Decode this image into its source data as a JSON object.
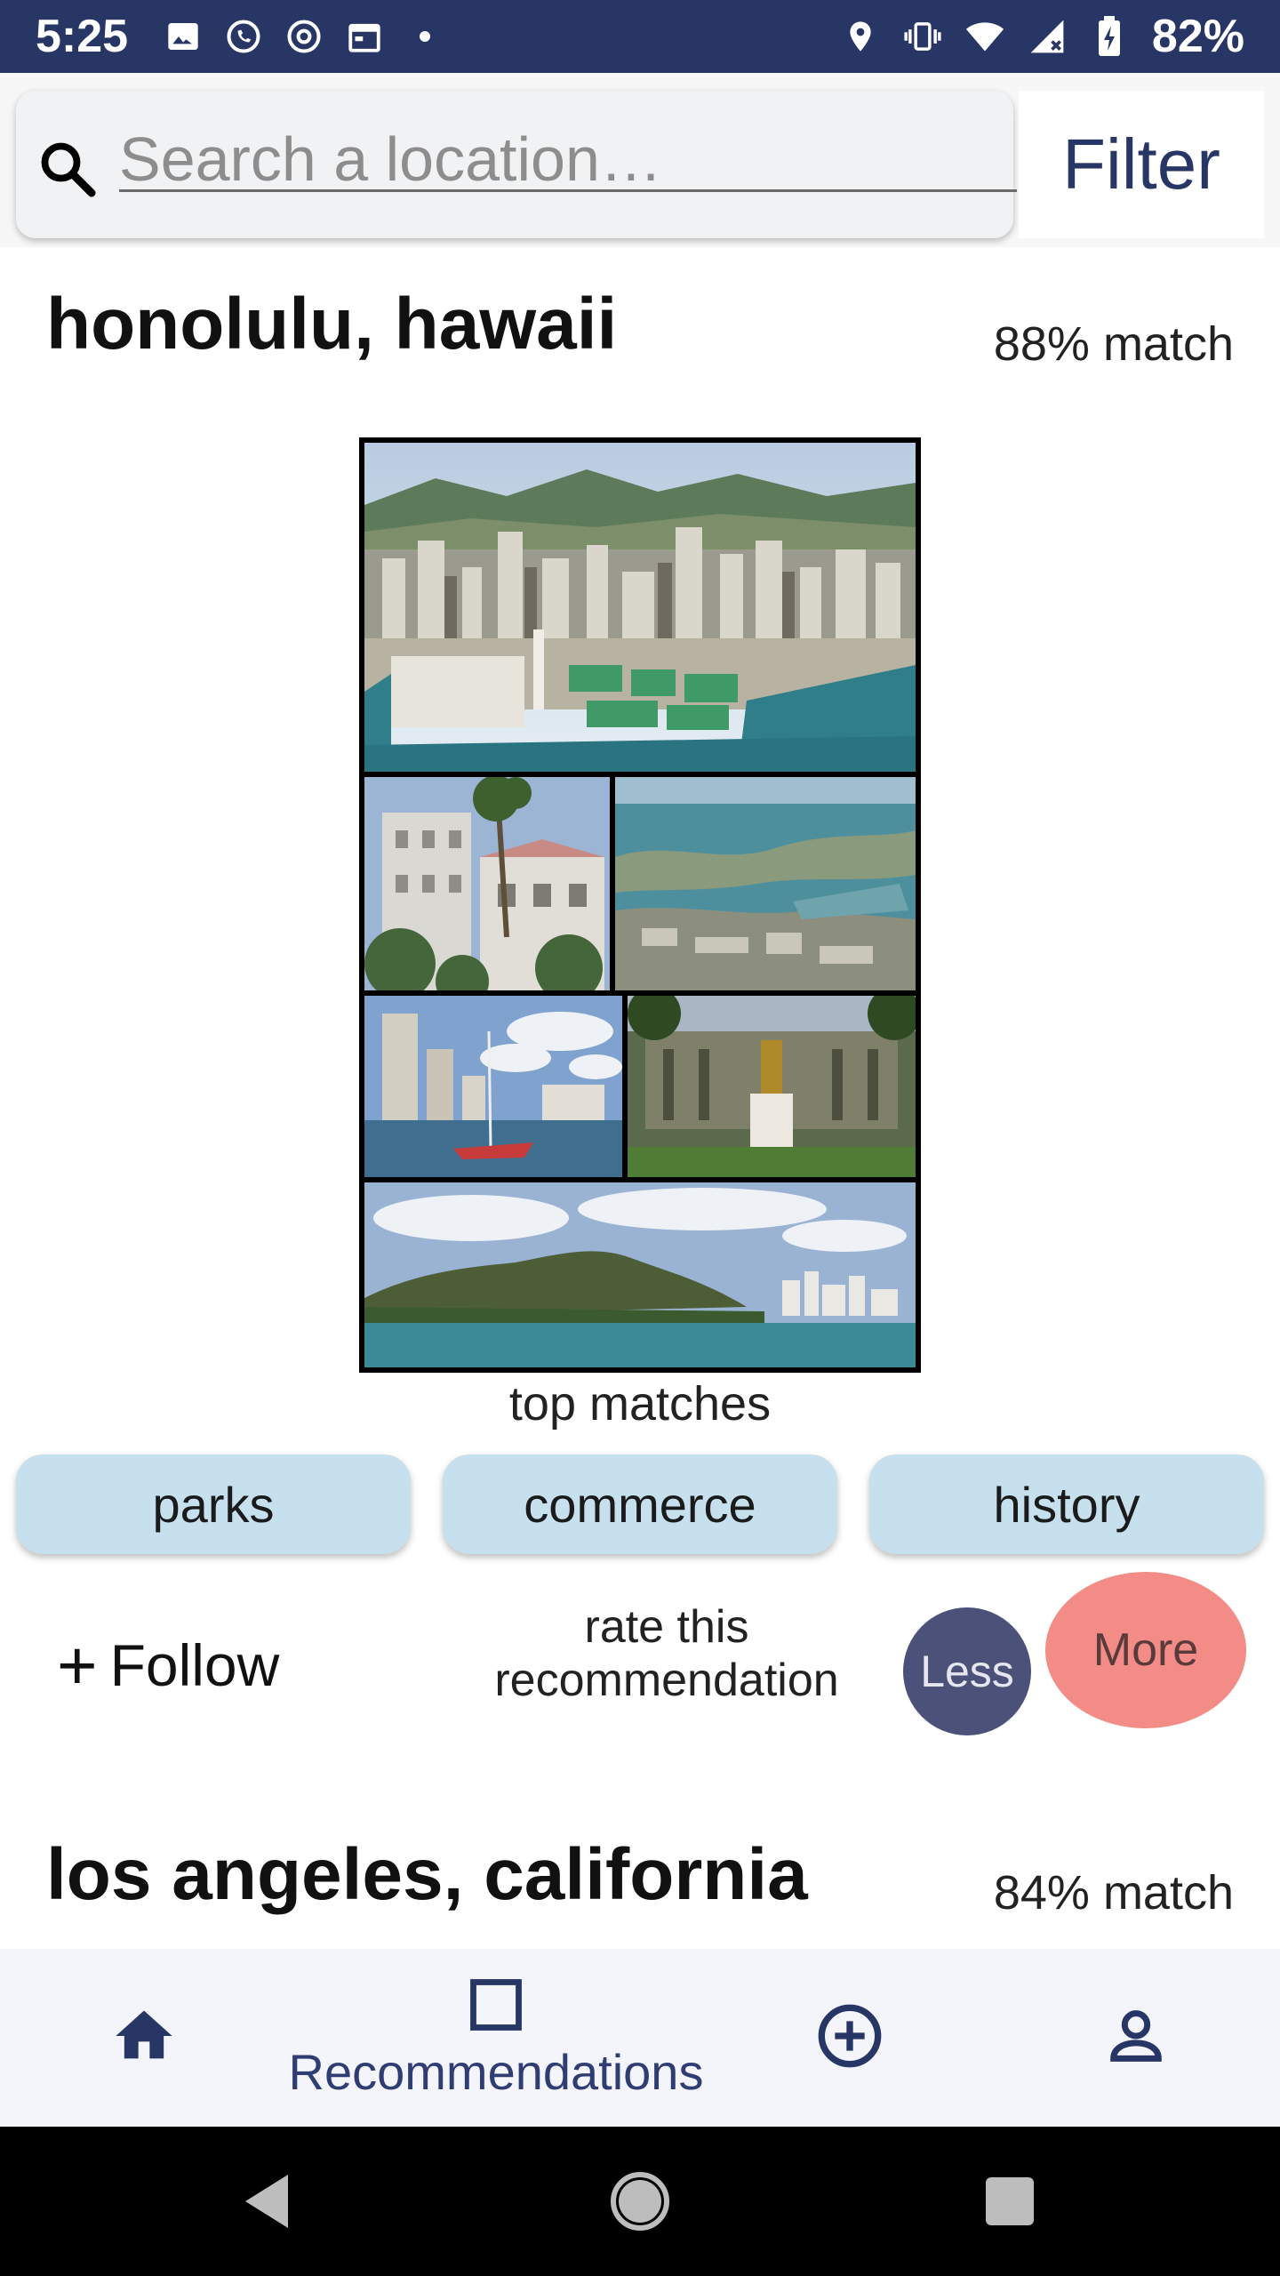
{
  "status_bar": {
    "time": "5:25",
    "battery_percent": "82%",
    "left_icons": [
      "image-icon",
      "whatsapp-icon",
      "at-sign-icon",
      "calendar-icon",
      "dot-icon"
    ],
    "right_icons": [
      "location-pin-icon",
      "vibrate-icon",
      "wifi-icon",
      "signal-icon",
      "battery-charging-icon"
    ]
  },
  "search": {
    "placeholder": "Search a location…",
    "value": "",
    "filter_label": "Filter"
  },
  "cards": [
    {
      "title": "honolulu, hawaii",
      "match": "88% match",
      "collage_caption": "top matches",
      "tags": [
        "parks",
        "commerce",
        "history"
      ],
      "follow_label": "Follow",
      "rate_label": "rate this recommendation",
      "less_label": "Less",
      "more_label": "More"
    },
    {
      "title": "los angeles, california",
      "match": "84% match"
    }
  ],
  "bottom_nav": {
    "items": [
      {
        "icon": "home-icon",
        "label": ""
      },
      {
        "icon": "square-icon",
        "label": "Recommendations"
      },
      {
        "icon": "add-circle-icon",
        "label": ""
      },
      {
        "icon": "person-icon",
        "label": ""
      }
    ]
  },
  "colors": {
    "primary": "#283665",
    "tag_bg": "#c7e0ee",
    "less_bg": "#4b5178",
    "more_bg": "#f38b86"
  }
}
